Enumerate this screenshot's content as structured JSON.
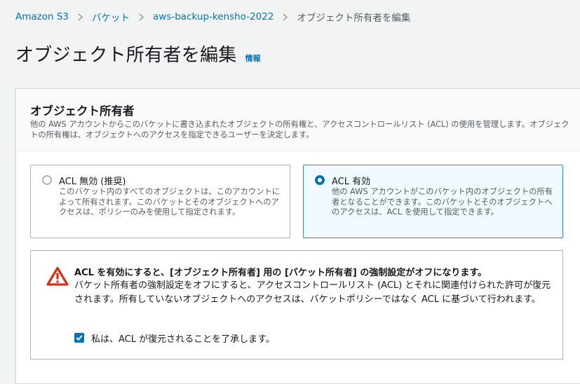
{
  "breadcrumb": {
    "items": [
      "Amazon S3",
      "バケット",
      "aws-backup-kensho-2022"
    ],
    "current": "オブジェクト所有者を編集"
  },
  "page": {
    "title": "オブジェクト所有者を編集",
    "info_link": "情報"
  },
  "section": {
    "title": "オブジェクト所有者",
    "description": "他の AWS アカウントからこのバケットに書き込まれたオブジェクトの所有権と、アクセスコントロールリスト (ACL) の使用を管理します。オブジェクトの所有権は、オブジェクトへのアクセスを指定できるユーザーを決定します。"
  },
  "options": [
    {
      "label": "ACL 無効 (推奨)",
      "description": "このバケット内のすべてのオブジェクトは、このアカウントによって所有されます。このバケットとそのオブジェクトへのアクセスは、ポリシーのみを使用して指定されます。",
      "selected": false
    },
    {
      "label": "ACL 有効",
      "description": "他の AWS アカウントがこのバケット内のオブジェクトの所有者となることができます。このバケットとそのオブジェクトへのアクセスは、ACL を使用して指定できます。",
      "selected": true
    }
  ],
  "warning": {
    "title": "ACL を有効にすると、[オブジェクト所有者] 用の [バケット所有者] の強制設定がオフになります。",
    "body": "バケット所有者の強制設定をオフにすると、アクセスコントロールリスト (ACL) とそれに関連付けられた許可が復元されます。所有していないオブジェクトへのアクセスは、バケットポリシーではなく ACL に基づいて行われます。",
    "checkbox_label": "私は、ACL が復元されることを了承します。",
    "checkbox_checked": true
  },
  "colors": {
    "link": "#0073bb",
    "warning": "#d13212",
    "selected_border": "#00a1c9",
    "selected_bg": "#f1faff"
  },
  "icons": {
    "breadcrumb_separator": "chevron-right-icon",
    "warning": "warning-icon"
  }
}
